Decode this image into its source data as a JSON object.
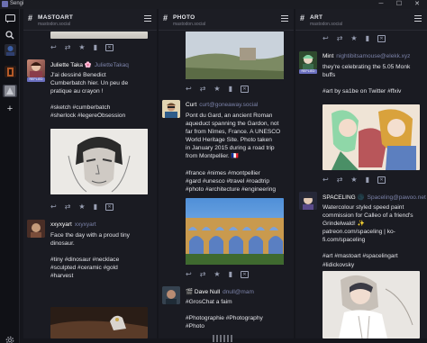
{
  "app": {
    "title": "Sengi"
  },
  "window": {
    "minimize": "─",
    "maximize": "☐",
    "close": "✕"
  },
  "sidebar": {
    "icons": [
      "compose-icon",
      "search-icon",
      "account-avatar",
      "account-avatar",
      "account-avatar",
      "add-account-icon",
      "settings-icon"
    ],
    "add": "+"
  },
  "columns": [
    {
      "title": "MASTOART",
      "subtitle": "mastodon.social",
      "posts": [
        {
          "name": "Juliette Taka",
          "emoji": "🌸",
          "handle": "JulietteTakaq",
          "badge": "REPLIED",
          "lines": [
            "J'ai dessiné Benedict",
            "Cumberbatch hier. Un peu de",
            "pratique au crayon !",
            "",
            "#sketch #cumberbatch",
            "#sherlock #legereObsession"
          ]
        },
        {
          "name": "xxyxyart",
          "handle": "xxyxyart",
          "lines": [
            "Face the day with a proud tiny",
            "dinosaur.",
            "",
            "#tiny #dinosaur #necklace",
            "#sculpted #ceramic #gold",
            "#harvest"
          ]
        }
      ]
    },
    {
      "title": "PHOTO",
      "subtitle": "mastodon.social",
      "posts": [
        {
          "name": "Curt",
          "handle": "curt@goneaway.social",
          "lines": [
            "Pont du Gard, an ancient Roman",
            "aqueduct spanning the Gardon, not",
            "far from Nîmes, France. A UNESCO",
            "World Heritage Site. Photo taken",
            "in January 2015 during a road trip",
            "from Montpellier. 🇫🇷",
            "",
            "#france #nimes #montpellier",
            "#gard #unesco #travel #roadtrip",
            "#photo #architecture #engineering"
          ]
        },
        {
          "name": "🎬 Dave Null",
          "handle": "dnull@mam",
          "lines": [
            "#GrosChat a faim",
            "",
            "#Photographie #Photography",
            "#Photo"
          ]
        }
      ]
    },
    {
      "title": "ART",
      "subtitle": "mastodon.social",
      "posts": [
        {
          "name": "Mint",
          "handle": "nightibitsamouse@elekk.xyz",
          "badge": "REPLIED",
          "lines": [
            "they're celebrating the 5.05 Monk",
            "buffs",
            "",
            "#art by sa1be on Twitter #ffxiv"
          ]
        },
        {
          "name": "SPACELING 🌑",
          "handle": "Spaceling@pawoo.net",
          "lines": [
            "Watercolour styled speed paint",
            "commission for Calleo of a friend's",
            "Grindelwald! ✨",
            "patreon.com/spaceling | ko-",
            "fi.com/spaceling",
            "",
            "#art #mastoart #spacelingart",
            "#lidickovsky"
          ]
        }
      ]
    }
  ]
}
